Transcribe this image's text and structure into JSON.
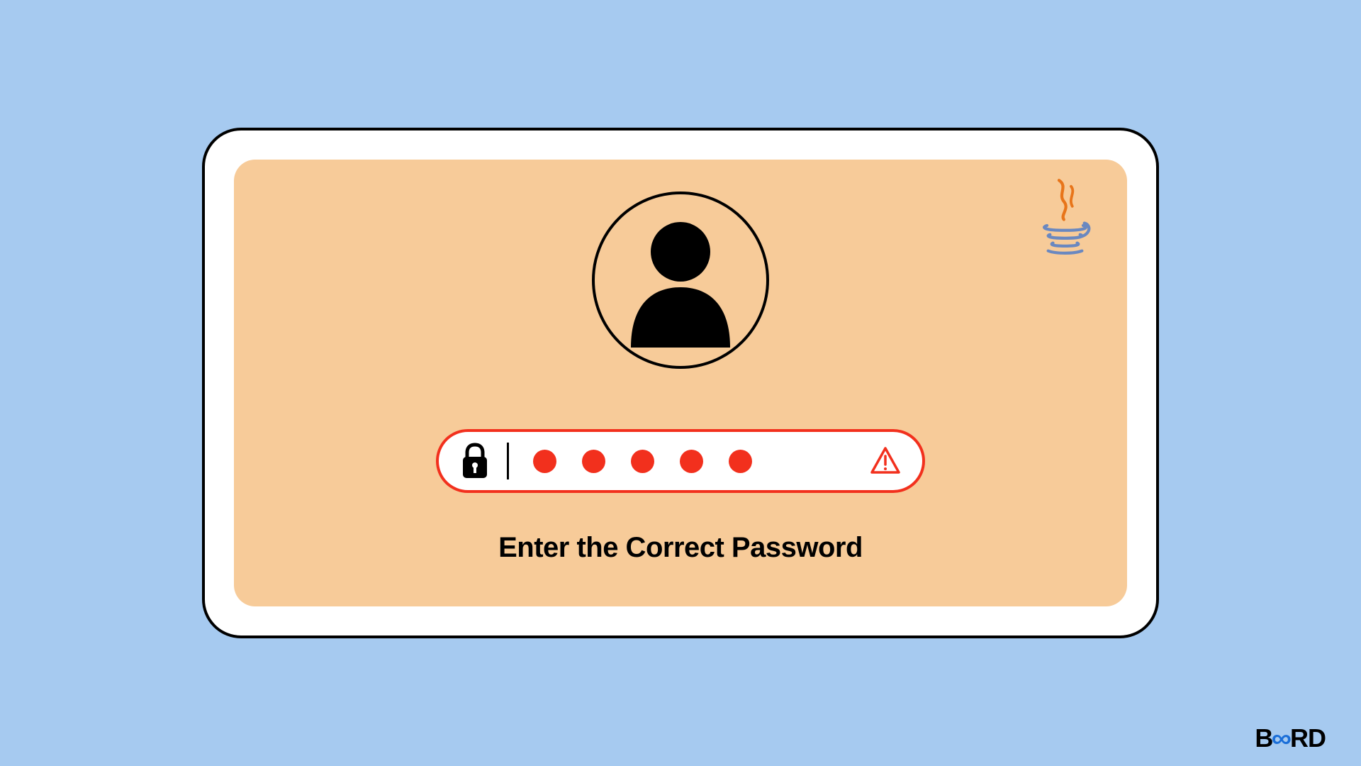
{
  "prompt_text": "Enter the Correct Password",
  "password": {
    "dot_count": 5,
    "error_state": true
  },
  "colors": {
    "background": "#a6caf0",
    "card_inner": "#f7cb99",
    "error": "#f2301d",
    "dot": "#f2301d"
  },
  "icons": {
    "avatar": "user-icon",
    "lock": "lock-icon",
    "warning": "warning-triangle-icon",
    "corner_logo": "java-icon"
  },
  "brand": {
    "prefix": "B",
    "infinity_glyph": "∞",
    "suffix": "RD"
  }
}
